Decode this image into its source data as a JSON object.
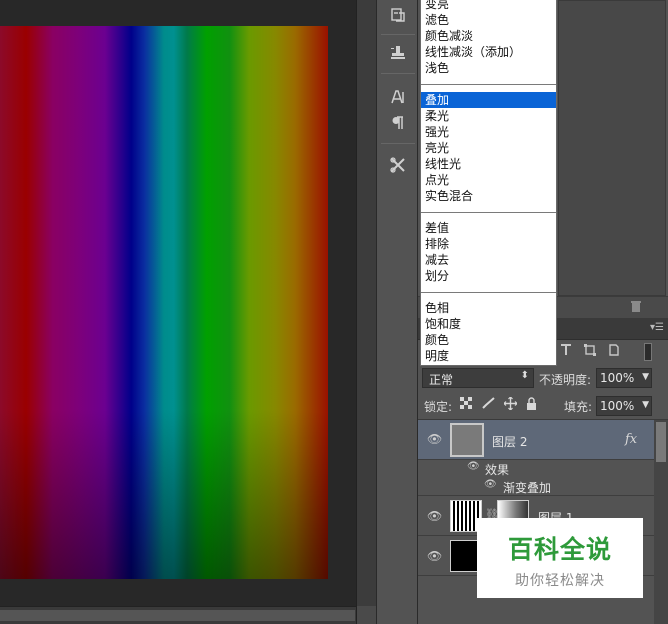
{
  "blend_menu": {
    "items": [
      {
        "label": "变亮",
        "selected": false
      },
      {
        "label": "滤色",
        "selected": false
      },
      {
        "label": "颜色减淡",
        "selected": false
      },
      {
        "label": "线性减淡（添加）",
        "selected": false
      },
      {
        "label": "浅色",
        "selected": false
      },
      {
        "label": "叠加",
        "selected": true
      },
      {
        "label": "柔光",
        "selected": false
      },
      {
        "label": "强光",
        "selected": false
      },
      {
        "label": "亮光",
        "selected": false
      },
      {
        "label": "线性光",
        "selected": false
      },
      {
        "label": "点光",
        "selected": false
      },
      {
        "label": "实色混合",
        "selected": false
      },
      {
        "label": "差值",
        "selected": false
      },
      {
        "label": "排除",
        "selected": false
      },
      {
        "label": "减去",
        "selected": false
      },
      {
        "label": "划分",
        "selected": false
      },
      {
        "label": "色相",
        "selected": false
      },
      {
        "label": "饱和度",
        "selected": false
      },
      {
        "label": "颜色",
        "selected": false
      },
      {
        "label": "明度",
        "selected": false
      }
    ]
  },
  "layers_panel": {
    "blend_mode": "正常",
    "opacity_label": "不透明度:",
    "opacity_value": "100%",
    "lock_label": "锁定:",
    "fill_label": "填充:",
    "fill_value": "100%",
    "layers": [
      {
        "name": "图层 2",
        "fx": "fx",
        "effects_label": "效果",
        "effect": "渐变叠加"
      },
      {
        "name": "图层 1"
      },
      {
        "name": ""
      }
    ]
  },
  "tool_strip": {
    "icons": [
      "history-icon",
      "clone-source-icon",
      "character-icon",
      "paragraph-icon",
      "tool-presets-icon"
    ]
  },
  "watermark": {
    "title": "百科全说",
    "subtitle": "助你轻松解决"
  },
  "colors": {
    "selection": "#0a64d6",
    "panel_bg": "#535353",
    "watermark_green": "#2e9a3a"
  }
}
